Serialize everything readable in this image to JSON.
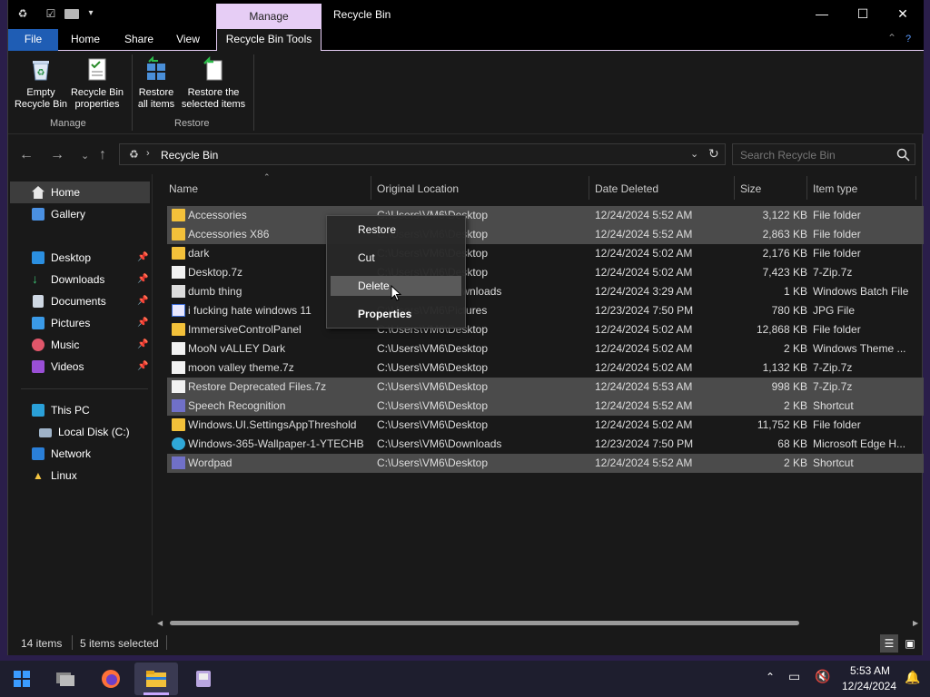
{
  "window": {
    "title": "Recycle Bin",
    "context_tab": "Manage",
    "minimize": "—",
    "maximize": "☐",
    "close": "✕"
  },
  "tabs": {
    "file": "File",
    "home": "Home",
    "share": "Share",
    "view": "View",
    "recycle_bin_tools": "Recycle Bin Tools"
  },
  "ribbon": {
    "empty_line1": "Empty",
    "empty_line2": "Recycle Bin",
    "props_line1": "Recycle Bin",
    "props_line2": "properties",
    "restore_all_line1": "Restore",
    "restore_all_line2": "all items",
    "restore_sel_line1": "Restore the",
    "restore_sel_line2": "selected items",
    "group_manage": "Manage",
    "group_restore": "Restore"
  },
  "address": {
    "path": "Recycle Bin",
    "search_placeholder": "Search Recycle Bin"
  },
  "sidebar": {
    "home": "Home",
    "gallery": "Gallery",
    "desktop": "Desktop",
    "downloads": "Downloads",
    "documents": "Documents",
    "pictures": "Pictures",
    "music": "Music",
    "videos": "Videos",
    "this_pc": "This PC",
    "local_disk": "Local Disk (C:)",
    "network": "Network",
    "linux": "Linux"
  },
  "columns": {
    "name": "Name",
    "location": "Original Location",
    "date": "Date Deleted",
    "size": "Size",
    "type": "Item type"
  },
  "files": [
    {
      "name": "Accessories",
      "loc": "C:\\Users\\VM6\\Desktop",
      "date": "12/24/2024 5:52 AM",
      "size": "3,122 KB",
      "type": "File folder",
      "icon": "folder",
      "selected": true
    },
    {
      "name": "Accessories X86",
      "loc": "C:\\Users\\VM6\\Desktop",
      "date": "12/24/2024 5:52 AM",
      "size": "2,863 KB",
      "type": "File folder",
      "icon": "folder",
      "selected": true
    },
    {
      "name": "dark",
      "loc": "C:\\Users\\VM6\\Desktop",
      "date": "12/24/2024 5:02 AM",
      "size": "2,176 KB",
      "type": "File folder",
      "icon": "folder",
      "selected": false
    },
    {
      "name": "Desktop.7z",
      "loc": "C:\\Users\\VM6\\Desktop",
      "date": "12/24/2024 5:02 AM",
      "size": "7,423 KB",
      "type": "7-Zip.7z",
      "icon": "doc",
      "selected": false
    },
    {
      "name": "dumb thing",
      "loc": "C:\\Users\\VM6\\Downloads",
      "date": "12/24/2024 3:29 AM",
      "size": "1 KB",
      "type": "Windows Batch File",
      "icon": "bat",
      "selected": false
    },
    {
      "name": "i fucking hate windows 11",
      "loc": "C:\\Users\\VM6\\Pictures",
      "date": "12/23/2024 7:50 PM",
      "size": "780 KB",
      "type": "JPG File",
      "icon": "jpg",
      "selected": false
    },
    {
      "name": "ImmersiveControlPanel",
      "loc": "C:\\Users\\VM6\\Desktop",
      "date": "12/24/2024 5:02 AM",
      "size": "12,868 KB",
      "type": "File folder",
      "icon": "folder",
      "selected": false
    },
    {
      "name": "MooN vALLEY Dark",
      "loc": "C:\\Users\\VM6\\Desktop",
      "date": "12/24/2024 5:02 AM",
      "size": "2 KB",
      "type": "Windows Theme ...",
      "icon": "theme",
      "selected": false
    },
    {
      "name": "moon valley theme.7z",
      "loc": "C:\\Users\\VM6\\Desktop",
      "date": "12/24/2024 5:02 AM",
      "size": "1,132 KB",
      "type": "7-Zip.7z",
      "icon": "doc",
      "selected": false
    },
    {
      "name": "Restore Deprecated Files.7z",
      "loc": "C:\\Users\\VM6\\Desktop",
      "date": "12/24/2024 5:53 AM",
      "size": "998 KB",
      "type": "7-Zip.7z",
      "icon": "doc",
      "selected": true
    },
    {
      "name": "Speech Recognition",
      "loc": "C:\\Users\\VM6\\Desktop",
      "date": "12/24/2024 5:52 AM",
      "size": "2 KB",
      "type": "Shortcut",
      "icon": "shortcut",
      "selected": true
    },
    {
      "name": "Windows.UI.SettingsAppThreshold",
      "loc": "C:\\Users\\VM6\\Desktop",
      "date": "12/24/2024 5:02 AM",
      "size": "11,752 KB",
      "type": "File folder",
      "icon": "folder",
      "selected": false
    },
    {
      "name": "Windows-365-Wallpaper-1-YTECHB",
      "loc": "C:\\Users\\VM6\\Downloads",
      "date": "12/23/2024 7:50 PM",
      "size": "68 KB",
      "type": "Microsoft Edge H...",
      "icon": "edge",
      "selected": false
    },
    {
      "name": "Wordpad",
      "loc": "C:\\Users\\VM6\\Desktop",
      "date": "12/24/2024 5:52 AM",
      "size": "2 KB",
      "type": "Shortcut",
      "icon": "shortcut",
      "selected": true
    }
  ],
  "context_menu": {
    "restore": "Restore",
    "cut": "Cut",
    "delete": "Delete",
    "properties": "Properties"
  },
  "status": {
    "count": "14 items",
    "selected": "5 items selected"
  },
  "taskbar": {
    "time": "5:53 AM",
    "date": "12/24/2024"
  },
  "colors": {
    "accent": "#e6cdf5",
    "file_tab": "#1f5db4",
    "selection": "#4b4b4b"
  }
}
